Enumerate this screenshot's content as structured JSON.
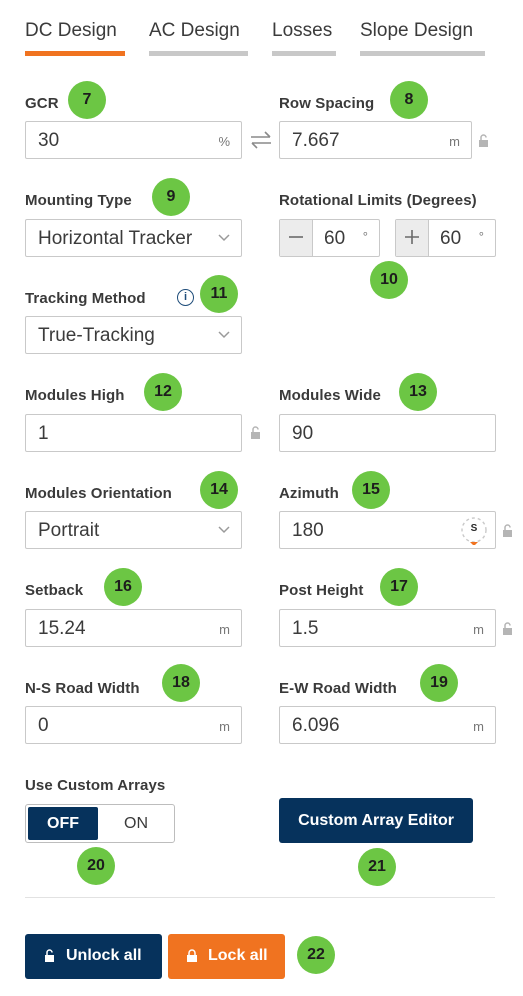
{
  "tabs": [
    {
      "label": "DC Design",
      "active": true
    },
    {
      "label": "AC Design",
      "active": false
    },
    {
      "label": "Losses",
      "active": false
    },
    {
      "label": "Slope Design",
      "active": false
    }
  ],
  "gcr": {
    "label": "GCR",
    "value": "30",
    "unit": "%",
    "badge": "7"
  },
  "swap_icon": "swap-arrows-icon",
  "row_spacing": {
    "label": "Row Spacing",
    "value": "7.667",
    "unit": "m",
    "badge": "8"
  },
  "mounting_type": {
    "label": "Mounting Type",
    "value": "Horizontal Tracker",
    "badge": "9"
  },
  "rotational_limits": {
    "label": "Rotational Limits (Degrees)",
    "min_value": "60",
    "max_value": "60",
    "unit": "°",
    "badge": "10"
  },
  "tracking_method": {
    "label": "Tracking Method",
    "value": "True-Tracking",
    "badge": "11",
    "info_icon": "i"
  },
  "modules_high": {
    "label": "Modules High",
    "value": "1",
    "badge": "12"
  },
  "modules_wide": {
    "label": "Modules Wide",
    "value": "90",
    "badge": "13"
  },
  "modules_orientation": {
    "label": "Modules Orientation",
    "value": "Portrait",
    "badge": "14"
  },
  "azimuth": {
    "label": "Azimuth",
    "value": "180",
    "badge": "15",
    "compass_letter": "S"
  },
  "setback": {
    "label": "Setback",
    "value": "15.24",
    "unit": "m",
    "badge": "16"
  },
  "post_height": {
    "label": "Post Height",
    "value": "1.5",
    "unit": "m",
    "badge": "17"
  },
  "ns_road_width": {
    "label": "N-S Road Width",
    "value": "0",
    "unit": "m",
    "badge": "18"
  },
  "ew_road_width": {
    "label": "E-W Road Width",
    "value": "6.096",
    "unit": "m",
    "badge": "19"
  },
  "custom_arrays": {
    "label": "Use Custom Arrays",
    "off_label": "OFF",
    "on_label": "ON",
    "badge": "20"
  },
  "custom_array_editor": {
    "label": "Custom Array Editor",
    "badge": "21"
  },
  "actions": {
    "unlock_label": "Unlock all",
    "lock_label": "Lock all",
    "badge": "22"
  },
  "colors": {
    "accent": "#f07320",
    "navy": "#06325c",
    "badge": "#6cc644"
  }
}
